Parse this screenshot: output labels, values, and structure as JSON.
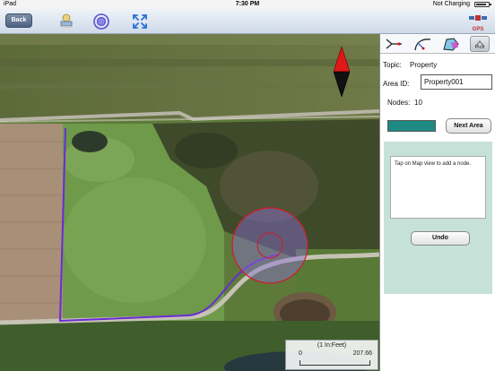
{
  "status_bar": {
    "device": "iPad",
    "time": "7:30 PM",
    "charging": "Not Charging",
    "battery_level": 0.75
  },
  "toolbar": {
    "back_label": "Back",
    "icons": [
      "layers-icon",
      "target-icon",
      "fullscreen-icon"
    ],
    "gps_label": "GPS"
  },
  "map": {
    "scale_title": "(1 In:Feet)",
    "scale_min": "0",
    "scale_max": "207.66",
    "compass": "north-arrow-icon",
    "boundary_color": "#6b2bd6",
    "circle_color": "#d21a2a"
  },
  "panel": {
    "tabs": [
      "line-tool-icon",
      "curve-tool-icon",
      "area-tool-icon",
      "pick-icon"
    ],
    "pick_label": "Pick",
    "topic_label": "Topic:",
    "topic_value": "Property",
    "area_id_label": "Area ID:",
    "area_id_value": "Property001",
    "nodes_label": "Nodes:",
    "nodes_value": "10",
    "swatch_color": "#1f8a84",
    "next_area_label": "Next Area",
    "message": "Tap on Map view to add a node.",
    "undo_label": "Undo",
    "body_color": "#c6e2d8"
  }
}
